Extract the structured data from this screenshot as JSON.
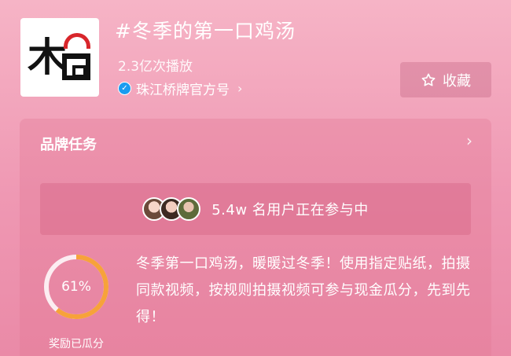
{
  "header": {
    "logo_char": "木",
    "title": "#冬季的第一口鸡汤",
    "plays": "2.3亿次播放",
    "account_name": "珠江桥牌官方号",
    "account_chevron": "›",
    "favorite_label": "收藏",
    "favorite_icon": "star-icon"
  },
  "task_card": {
    "title": "品牌任务",
    "chevron": "›",
    "participants_text": "5.4w 名用户正在参与中",
    "progress_percent": 61,
    "progress_label": "61%",
    "reward_label": "奖励已瓜分",
    "description": "冬季第一口鸡汤，暖暖过冬季！使用指定贴纸，拍摄同款视频，按规则拍摄视频可参与现金瓜分，先到先得！"
  },
  "colors": {
    "progress_fill": "#f7a23a",
    "progress_track": "#ffffff",
    "verify_badge": "#1a9cf0",
    "logo_arc": "#d8262b"
  }
}
